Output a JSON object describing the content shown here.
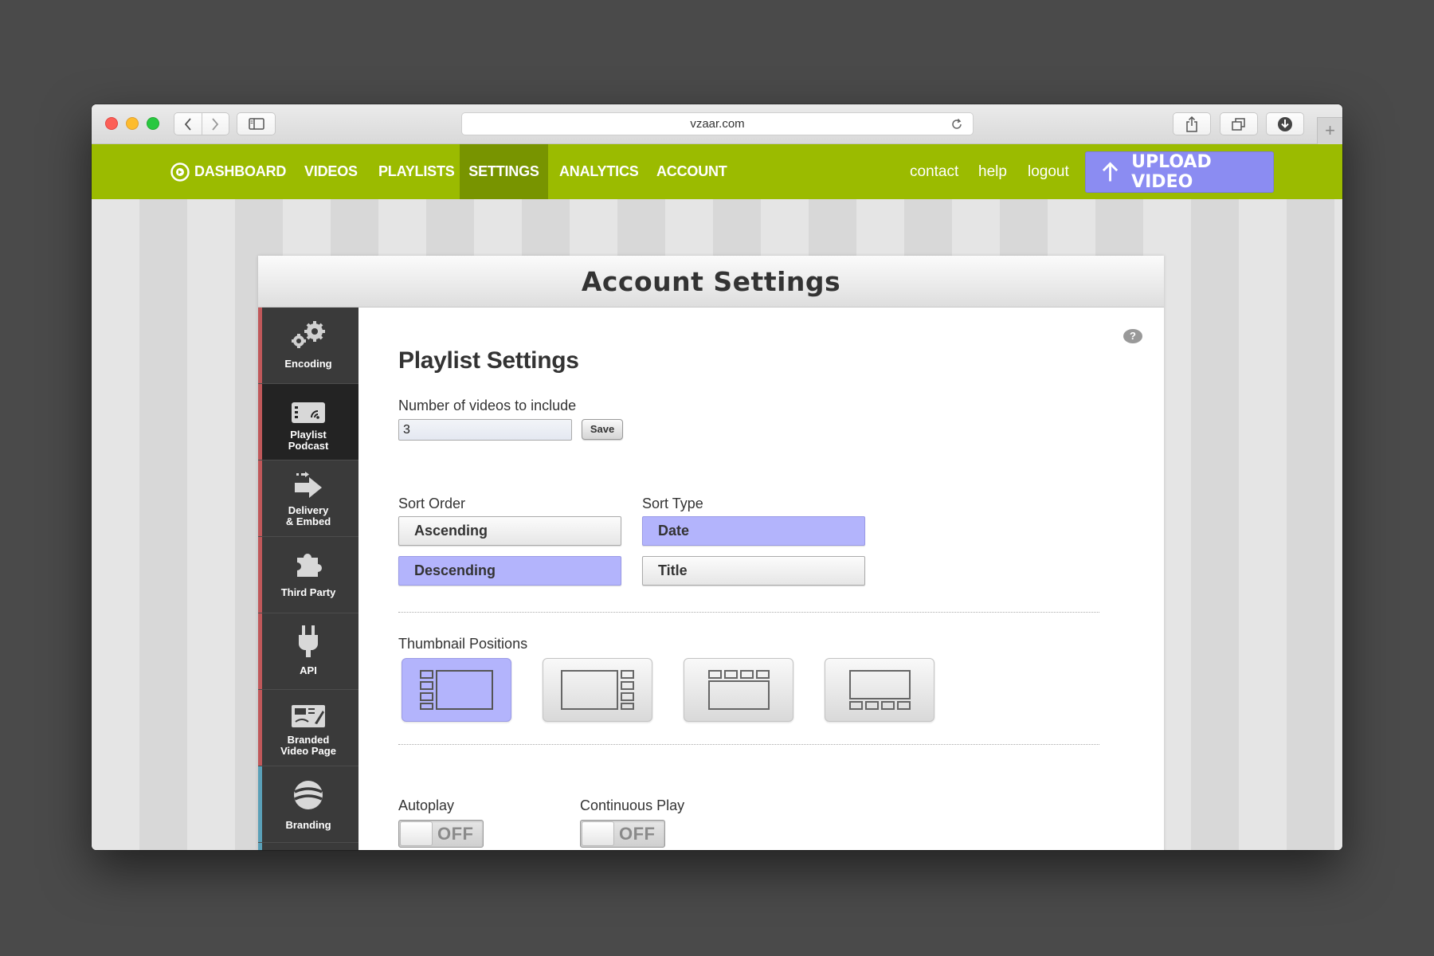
{
  "browser": {
    "url": "vzaar.com"
  },
  "topnav": {
    "items": [
      {
        "label": "DASHBOARD"
      },
      {
        "label": "VIDEOS"
      },
      {
        "label": "PLAYLISTS"
      },
      {
        "label": "SETTINGS",
        "active": true
      },
      {
        "label": "ANALYTICS"
      },
      {
        "label": "ACCOUNT"
      }
    ],
    "links": [
      "contact",
      "help",
      "logout"
    ],
    "upload_label": "UPLOAD VIDEO",
    "colors": {
      "bar": "#9bbb00",
      "active": "#789400",
      "upload": "#8b8cf2"
    }
  },
  "panel": {
    "title": "Account Settings"
  },
  "sidenav": {
    "items": [
      {
        "label": "Encoding",
        "icon": "gears-icon"
      },
      {
        "label": "Playlist Podcast",
        "icon": "playlist-podcast-icon",
        "active": true
      },
      {
        "label": "Delivery & Embed",
        "icon": "delivery-arrow-icon"
      },
      {
        "label": "Third Party",
        "icon": "puzzle-piece-icon"
      },
      {
        "label": "API",
        "icon": "plug-icon"
      },
      {
        "label": "Branded Video Page",
        "icon": "branded-page-icon"
      },
      {
        "label": "Branding",
        "icon": "branding-globe-icon"
      }
    ]
  },
  "settings": {
    "help_glyph": "?",
    "section_title": "Playlist Settings",
    "num_videos_label": "Number of videos to include",
    "num_videos_value": "3",
    "save_label": "Save",
    "sort_order_label": "Sort Order",
    "sort_order_options": [
      {
        "label": "Ascending",
        "selected": false
      },
      {
        "label": "Descending",
        "selected": true
      }
    ],
    "sort_type_label": "Sort Type",
    "sort_type_options": [
      {
        "label": "Date",
        "selected": true
      },
      {
        "label": "Title",
        "selected": false
      }
    ],
    "thumbnail_label": "Thumbnail Positions",
    "thumbnail_options": [
      {
        "position": "left",
        "selected": true
      },
      {
        "position": "right",
        "selected": false
      },
      {
        "position": "top",
        "selected": false
      },
      {
        "position": "bottom",
        "selected": false
      }
    ],
    "autoplay_label": "Autoplay",
    "autoplay_state": "OFF",
    "continuous_label": "Continuous Play",
    "continuous_state": "OFF",
    "selected_color": "#b3b4fc"
  }
}
